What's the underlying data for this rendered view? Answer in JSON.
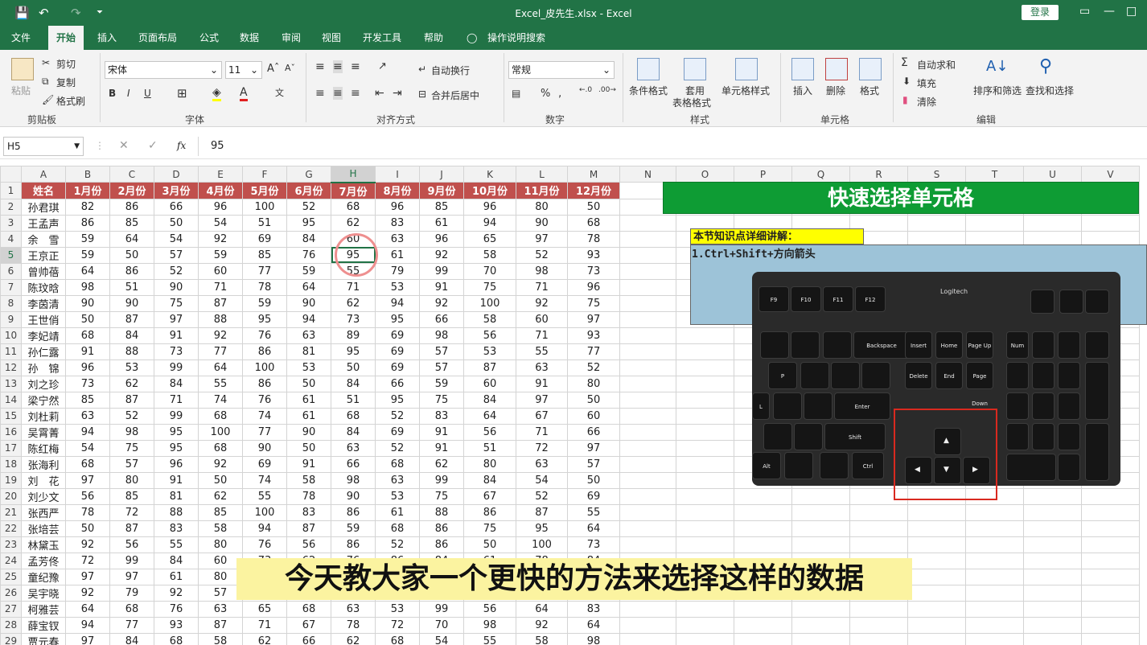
{
  "window": {
    "title": "Excel_皮先生.xlsx  -  Excel",
    "login_label": "登录",
    "min_icon": "minimize-icon",
    "restore_icon": "restore-icon",
    "close_icon": "close-icon"
  },
  "quick_access": {
    "save_icon": "save-icon",
    "undo_icon": "undo-icon",
    "redo_icon": "redo-icon",
    "customize_icon": "customize-icon"
  },
  "menu": {
    "tabs": [
      "文件",
      "开始",
      "插入",
      "页面布局",
      "公式",
      "数据",
      "审阅",
      "视图",
      "开发工具",
      "帮助"
    ],
    "active": "开始",
    "tell_me": "操作说明搜索",
    "tell_me_icon": "lightbulb-icon"
  },
  "ribbon": {
    "clipboard": {
      "label": "剪贴板",
      "paste": "粘贴",
      "cut": "剪切",
      "copy": "复制",
      "format_painter": "格式刷"
    },
    "font": {
      "label": "字体",
      "font_name": "宋体",
      "font_size": "11",
      "bold": "B",
      "italic": "I",
      "underline": "U"
    },
    "alignment": {
      "label": "对齐方式",
      "wrap": "自动换行",
      "merge": "合并后居中"
    },
    "number": {
      "label": "数字",
      "format": "常规",
      "percent": "%"
    },
    "styles": {
      "label": "样式",
      "conditional": "条件格式",
      "table_format_1": "套用",
      "table_format_2": "表格格式",
      "cell_styles": "单元格样式"
    },
    "cells": {
      "label": "单元格",
      "insert": "插入",
      "delete": "删除",
      "format": "格式"
    },
    "editing": {
      "label": "编辑",
      "autosum": "自动求和",
      "fill": "填充",
      "clear": "清除",
      "sort_filter": "排序和筛选",
      "find_select": "查找和选择"
    }
  },
  "formula_bar": {
    "name_box": "H5",
    "value": "95",
    "fx": "fx"
  },
  "sheet": {
    "columns": [
      "A",
      "B",
      "C",
      "D",
      "E",
      "F",
      "G",
      "H",
      "I",
      "J",
      "K",
      "L",
      "M",
      "N",
      "O",
      "P",
      "Q",
      "R",
      "S",
      "T",
      "U",
      "V"
    ],
    "active_col": "H",
    "active_row": 5,
    "header_row": [
      "姓名",
      "1月份",
      "2月份",
      "3月份",
      "4月份",
      "5月份",
      "6月份",
      "7月份",
      "8月份",
      "9月份",
      "10月份",
      "11月份",
      "12月份"
    ],
    "rows": [
      [
        "孙君琪",
        "82",
        "86",
        "66",
        "96",
        "100",
        "52",
        "68",
        "96",
        "85",
        "96",
        "80",
        "50"
      ],
      [
        "王孟声",
        "86",
        "85",
        "50",
        "54",
        "51",
        "95",
        "62",
        "83",
        "61",
        "94",
        "90",
        "68"
      ],
      [
        "余　雪",
        "59",
        "64",
        "54",
        "92",
        "69",
        "84",
        "60",
        "63",
        "96",
        "65",
        "97",
        "78"
      ],
      [
        "王京正",
        "59",
        "50",
        "57",
        "59",
        "85",
        "76",
        "95",
        "61",
        "92",
        "58",
        "52",
        "93"
      ],
      [
        "曾帅蓓",
        "64",
        "86",
        "52",
        "60",
        "77",
        "59",
        "55",
        "79",
        "99",
        "70",
        "98",
        "73"
      ],
      [
        "陈玟晗",
        "98",
        "51",
        "90",
        "71",
        "78",
        "64",
        "71",
        "53",
        "91",
        "75",
        "71",
        "96"
      ],
      [
        "李茵清",
        "90",
        "90",
        "75",
        "87",
        "59",
        "90",
        "62",
        "94",
        "92",
        "100",
        "92",
        "75"
      ],
      [
        "王世俏",
        "50",
        "87",
        "97",
        "88",
        "95",
        "94",
        "73",
        "95",
        "66",
        "58",
        "60",
        "97"
      ],
      [
        "李妃靖",
        "68",
        "84",
        "91",
        "92",
        "76",
        "63",
        "89",
        "69",
        "98",
        "56",
        "71",
        "93"
      ],
      [
        "孙仁露",
        "91",
        "88",
        "73",
        "77",
        "86",
        "81",
        "95",
        "69",
        "57",
        "53",
        "55",
        "77"
      ],
      [
        "孙　锦",
        "96",
        "53",
        "99",
        "64",
        "100",
        "53",
        "50",
        "69",
        "57",
        "87",
        "63",
        "52"
      ],
      [
        "刘之珍",
        "73",
        "62",
        "84",
        "55",
        "86",
        "50",
        "84",
        "66",
        "59",
        "60",
        "91",
        "80"
      ],
      [
        "梁宁然",
        "85",
        "87",
        "71",
        "74",
        "76",
        "61",
        "51",
        "95",
        "75",
        "84",
        "97",
        "50"
      ],
      [
        "刘杜莉",
        "63",
        "52",
        "99",
        "68",
        "74",
        "61",
        "68",
        "52",
        "83",
        "64",
        "67",
        "60"
      ],
      [
        "吴霄菁",
        "94",
        "98",
        "95",
        "100",
        "77",
        "90",
        "84",
        "69",
        "91",
        "56",
        "71",
        "66"
      ],
      [
        "陈红梅",
        "54",
        "75",
        "95",
        "68",
        "90",
        "50",
        "63",
        "52",
        "91",
        "51",
        "72",
        "97"
      ],
      [
        "张海利",
        "68",
        "57",
        "96",
        "92",
        "69",
        "91",
        "66",
        "68",
        "62",
        "80",
        "63",
        "57"
      ],
      [
        "刘　花",
        "97",
        "80",
        "91",
        "50",
        "74",
        "58",
        "98",
        "63",
        "99",
        "84",
        "54",
        "50"
      ],
      [
        "刘少文",
        "56",
        "85",
        "81",
        "62",
        "55",
        "78",
        "90",
        "53",
        "75",
        "67",
        "52",
        "69"
      ],
      [
        "张西严",
        "78",
        "72",
        "88",
        "85",
        "100",
        "83",
        "86",
        "61",
        "88",
        "86",
        "87",
        "55"
      ],
      [
        "张培芸",
        "50",
        "87",
        "83",
        "58",
        "94",
        "87",
        "59",
        "68",
        "86",
        "75",
        "95",
        "64"
      ],
      [
        "林黛玉",
        "92",
        "56",
        "55",
        "80",
        "76",
        "56",
        "86",
        "52",
        "86",
        "50",
        "100",
        "73"
      ],
      [
        "孟芳佟",
        "72",
        "99",
        "84",
        "60",
        "73",
        "62",
        "76",
        "86",
        "84",
        "61",
        "78",
        "84"
      ],
      [
        "童纪豫",
        "97",
        "97",
        "61",
        "80",
        "",
        "",
        "",
        "",
        "",
        "",
        "",
        ""
      ],
      [
        "吴宇晓",
        "92",
        "79",
        "92",
        "57",
        "",
        "",
        "",
        "",
        "",
        "",
        "",
        ""
      ],
      [
        "柯雅芸",
        "64",
        "68",
        "76",
        "63",
        "65",
        "68",
        "63",
        "53",
        "99",
        "56",
        "64",
        "83"
      ],
      [
        "薛宝钗",
        "94",
        "77",
        "93",
        "87",
        "71",
        "67",
        "78",
        "72",
        "70",
        "98",
        "92",
        "64"
      ],
      [
        "贾元春",
        "97",
        "84",
        "68",
        "58",
        "62",
        "66",
        "62",
        "68",
        "54",
        "55",
        "58",
        "98"
      ]
    ]
  },
  "overlay": {
    "banner": "快速选择单元格",
    "knowledge_title": "本节知识点详细讲解：",
    "knowledge_line1": "1.Ctrl+Shift+方向箭头",
    "subtitle": "今天教大家一个更快的方法来选择这样的数据",
    "keyboard_brand": "Logitech",
    "keys": {
      "f9": "F9",
      "f10": "F10",
      "f11": "F11",
      "f12": "F12",
      "backspace": "Backspace",
      "insert": "Insert",
      "home": "Home",
      "pgup": "Page Up",
      "delete": "Delete",
      "end": "End",
      "pgdn": "Page Down",
      "enter": "Enter",
      "shift": "Shift",
      "ctrl": "Ctrl",
      "alt": "Alt",
      "numlock": "Num Lock",
      "p": "P",
      "l": "L"
    },
    "keyboard_icons": [
      "arrow-up-icon",
      "arrow-left-icon",
      "arrow-down-icon",
      "arrow-right-icon"
    ]
  }
}
